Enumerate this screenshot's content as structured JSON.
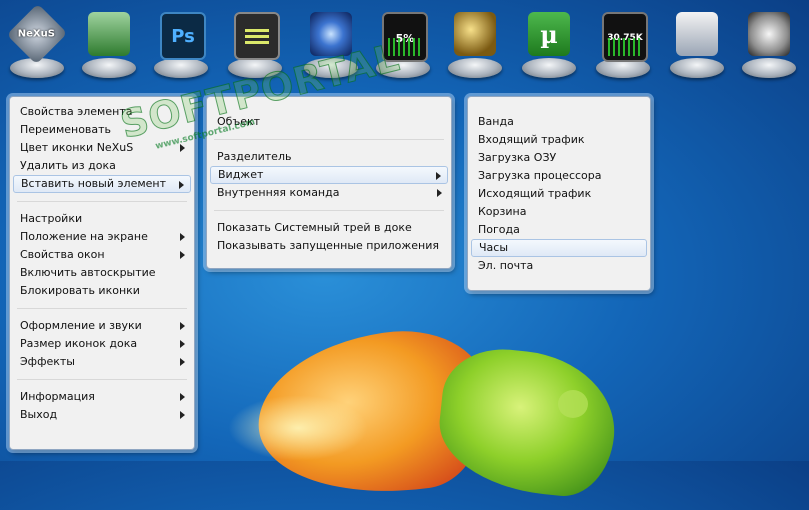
{
  "dock": {
    "items": [
      {
        "icon": "nexus-logo-icon",
        "label": "NeXuS"
      },
      {
        "icon": "server-icon"
      },
      {
        "icon": "photoshop-icon",
        "label": "Ps"
      },
      {
        "icon": "terminal-icon"
      },
      {
        "icon": "star-burst-icon"
      },
      {
        "icon": "cpu-meter-icon",
        "label": "5%"
      },
      {
        "icon": "globe-icon"
      },
      {
        "icon": "utorrent-icon",
        "label": "µ"
      },
      {
        "icon": "network-meter-icon",
        "label": "30.75K"
      },
      {
        "icon": "media-icon"
      },
      {
        "icon": "clock-icon"
      }
    ]
  },
  "watermark": {
    "big": "SOFTPORTAL",
    "small": "www.softportal.com"
  },
  "menu_main": {
    "group1": [
      {
        "label": "Свойства элемента",
        "submenu": false
      },
      {
        "label": "Переименовать",
        "submenu": false
      },
      {
        "label": "Цвет иконки NeXuS",
        "submenu": true
      },
      {
        "label": "Удалить из дока",
        "submenu": false
      },
      {
        "label": "Вставить новый элемент",
        "submenu": true,
        "highlighted": true
      }
    ],
    "group2": [
      {
        "label": "Настройки",
        "submenu": false
      },
      {
        "label": "Положение на экране",
        "submenu": true
      },
      {
        "label": "Свойства окон",
        "submenu": true
      },
      {
        "label": "Включить автоскрытие",
        "submenu": false
      },
      {
        "label": "Блокировать иконки",
        "submenu": false
      }
    ],
    "group3": [
      {
        "label": "Оформление и звуки",
        "submenu": true
      },
      {
        "label": "Размер иконок дока",
        "submenu": true
      },
      {
        "label": "Эффекты",
        "submenu": true
      }
    ],
    "group4": [
      {
        "label": "Информация",
        "submenu": true
      },
      {
        "label": "Выход",
        "submenu": true
      }
    ]
  },
  "menu_insert": {
    "group1": [
      {
        "label": "Объект",
        "submenu": false
      }
    ],
    "group2": [
      {
        "label": "Разделитель",
        "submenu": false
      },
      {
        "label": "Виджет",
        "submenu": true,
        "highlighted": true
      },
      {
        "label": "Внутренняя команда",
        "submenu": true
      }
    ],
    "group3": [
      {
        "label": "Показать Системный трей в доке",
        "submenu": false
      },
      {
        "label": "Показывать запущенные приложения",
        "submenu": false
      }
    ]
  },
  "menu_widget": {
    "items": [
      {
        "label": "Ванда"
      },
      {
        "label": "Входящий трафик"
      },
      {
        "label": "Загрузка ОЗУ"
      },
      {
        "label": "Загрузка процессора"
      },
      {
        "label": "Исходящий трафик"
      },
      {
        "label": "Корзина"
      },
      {
        "label": "Погода"
      },
      {
        "label": "Часы",
        "highlighted": true
      },
      {
        "label": "Эл. почта"
      }
    ]
  }
}
